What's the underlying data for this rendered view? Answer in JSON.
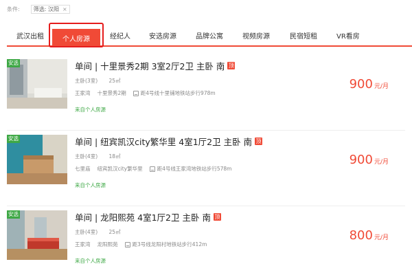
{
  "filter": {
    "label": "条件:",
    "chip_text": "筛选: 汉阳",
    "chip_close": "×"
  },
  "tabs": [
    {
      "label": "武汉出租"
    },
    {
      "label": "个人房源"
    },
    {
      "label": "经纪人"
    },
    {
      "label": "安选房源"
    },
    {
      "label": "品牌公寓"
    },
    {
      "label": "视频房源"
    },
    {
      "label": "民宿短租"
    },
    {
      "label": "VR看房"
    }
  ],
  "active_tab": "个人房源",
  "listings": [
    {
      "badge": "安选",
      "title": "单间 | 十里景秀2期 3室2厅2卫 主卧 南",
      "top_tag": "顶",
      "room": "主卧(3室)",
      "area": "25㎡",
      "district": "王家湾",
      "community": "十里景秀2期",
      "subway": "距4号线十里铺地铁站步行978m",
      "source": "来自个人房源",
      "price": "900",
      "unit": "元/月"
    },
    {
      "badge": "安选",
      "title": "单间 | 纽宾凯汉city繁华里 4室1厅2卫 主卧 南",
      "top_tag": "顶",
      "room": "主卧(4室)",
      "area": "18㎡",
      "district": "七里庙",
      "community": "纽宾凯汉city繁华里",
      "subway": "距4号线王家湾地铁站步行578m",
      "source": "来自个人房源",
      "price": "900",
      "unit": "元/月"
    },
    {
      "badge": "安选",
      "title": "单间 | 龙阳熙苑 4室1厅2卫 主卧 南",
      "top_tag": "顶",
      "room": "主卧(4室)",
      "area": "25㎡",
      "district": "王家湾",
      "community": "龙阳熙苑",
      "subway": "距3号线龙阳村地铁站步行412m",
      "source": "来自个人房源",
      "price": "800",
      "unit": "元/月"
    }
  ],
  "colors": {
    "accent": "#f04a36",
    "green": "#3ea845",
    "highlight": "#e51c1c"
  }
}
